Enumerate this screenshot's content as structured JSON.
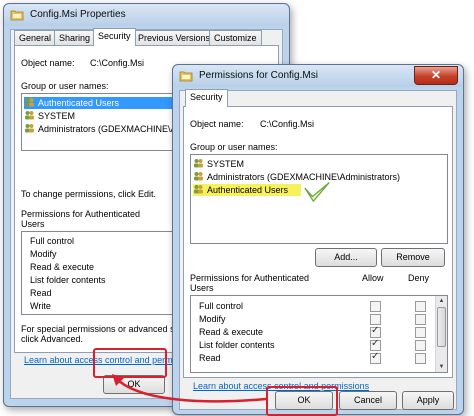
{
  "colors": {
    "highlight_red": "#d8202e",
    "selection_blue": "#3399ff",
    "marker_yellow": "#f7f25a"
  },
  "back_window": {
    "title": "Config.Msi Properties",
    "icon": "folder-properties-icon",
    "close_label": "✕",
    "tabs": [
      "General",
      "Sharing",
      "Security",
      "Previous Versions",
      "Customize"
    ],
    "active_tab": "Security",
    "object_name_label": "Object name:",
    "object_name_value": "C:\\Config.Msi",
    "group_label": "Group or user names:",
    "users": [
      "Authenticated Users",
      "SYSTEM",
      "Administrators (GDEXMACHINE\\Ad"
    ],
    "selected_user": "Authenticated Users",
    "change_text": "To change permissions, click Edit.",
    "permissions_for_line1": "Permissions for Authenticated",
    "permissions_for_line2": "Users",
    "permissions": [
      "Full control",
      "Modify",
      "Read & execute",
      "List folder contents",
      "Read",
      "Write"
    ],
    "special_line1": "For special permissions or advanced set",
    "special_line2": "click Advanced.",
    "learn_link": "Learn about access control and permission",
    "ok_label": "OK"
  },
  "front_window": {
    "title": "Permissions for Config.Msi",
    "icon": "folder-permissions-icon",
    "close_label": "✕",
    "tab": "Security",
    "object_name_label": "Object name:",
    "object_name_value": "C:\\Config.Msi",
    "group_label": "Group or user names:",
    "users": [
      "SYSTEM",
      "Administrators (GDEXMACHINE\\Administrators)",
      "Authenticated Users"
    ],
    "selected_user": "Authenticated Users",
    "add_label": "Add...",
    "remove_label": "Remove",
    "permissions_for_line1": "Permissions for Authenticated",
    "permissions_for_line2": "Users",
    "allow_header": "Allow",
    "deny_header": "Deny",
    "permissions": [
      {
        "name": "Full control",
        "allow": false,
        "deny": false
      },
      {
        "name": "Modify",
        "allow": false,
        "deny": false
      },
      {
        "name": "Read & execute",
        "allow": true,
        "deny": false
      },
      {
        "name": "List folder contents",
        "allow": true,
        "deny": false
      },
      {
        "name": "Read",
        "allow": true,
        "deny": false
      }
    ],
    "learn_link": "Learn about access control and permissions",
    "ok_label": "OK",
    "cancel_label": "Cancel",
    "apply_label": "Apply"
  }
}
